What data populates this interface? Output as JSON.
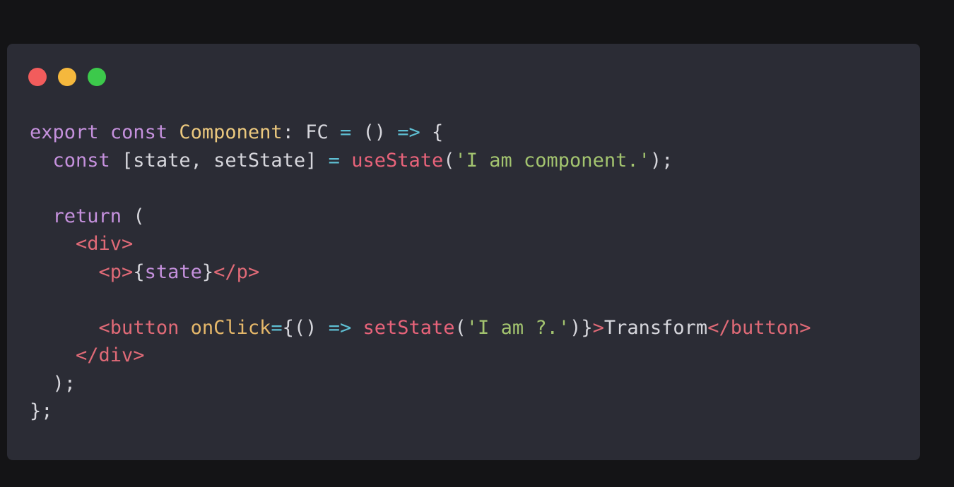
{
  "window": {
    "controls": [
      {
        "name": "close",
        "color": "#f25c5c"
      },
      {
        "name": "minimize",
        "color": "#f5b83d"
      },
      {
        "name": "maximize",
        "color": "#3cc94b"
      }
    ]
  },
  "code": {
    "language": "tsx",
    "lines": [
      [
        {
          "t": "export",
          "c": "kw"
        },
        {
          "t": " ",
          "c": "pl"
        },
        {
          "t": "const",
          "c": "kw"
        },
        {
          "t": " ",
          "c": "pl"
        },
        {
          "t": "Component",
          "c": "cls"
        },
        {
          "t": ": ",
          "c": "pl"
        },
        {
          "t": "FC",
          "c": "pl"
        },
        {
          "t": " ",
          "c": "pl"
        },
        {
          "t": "=",
          "c": "op"
        },
        {
          "t": " () ",
          "c": "pl"
        },
        {
          "t": "=>",
          "c": "op"
        },
        {
          "t": " {",
          "c": "pl"
        }
      ],
      [
        {
          "t": "  ",
          "c": "pl"
        },
        {
          "t": "const",
          "c": "kw"
        },
        {
          "t": " [state, setState] ",
          "c": "pl"
        },
        {
          "t": "=",
          "c": "op"
        },
        {
          "t": " ",
          "c": "pl"
        },
        {
          "t": "useState",
          "c": "fn"
        },
        {
          "t": "(",
          "c": "pl"
        },
        {
          "t": "'I am component.'",
          "c": "str"
        },
        {
          "t": ");",
          "c": "pl"
        }
      ],
      [],
      [
        {
          "t": "  ",
          "c": "pl"
        },
        {
          "t": "return",
          "c": "kw"
        },
        {
          "t": " (",
          "c": "pl"
        }
      ],
      [
        {
          "t": "    ",
          "c": "pl"
        },
        {
          "t": "<div>",
          "c": "tag"
        }
      ],
      [
        {
          "t": "      ",
          "c": "pl"
        },
        {
          "t": "<p>",
          "c": "tag"
        },
        {
          "t": "{",
          "c": "pl"
        },
        {
          "t": "state",
          "c": "kw"
        },
        {
          "t": "}",
          "c": "pl"
        },
        {
          "t": "</p>",
          "c": "tag"
        }
      ],
      [],
      [
        {
          "t": "      ",
          "c": "pl"
        },
        {
          "t": "<button",
          "c": "tag"
        },
        {
          "t": " ",
          "c": "pl"
        },
        {
          "t": "onClick",
          "c": "attr"
        },
        {
          "t": "=",
          "c": "op"
        },
        {
          "t": "{() ",
          "c": "pl"
        },
        {
          "t": "=>",
          "c": "op"
        },
        {
          "t": " ",
          "c": "pl"
        },
        {
          "t": "setState",
          "c": "fn"
        },
        {
          "t": "(",
          "c": "pl"
        },
        {
          "t": "'I am ?.'",
          "c": "str"
        },
        {
          "t": ")}",
          "c": "pl"
        },
        {
          "t": ">",
          "c": "tag"
        },
        {
          "t": "Transform",
          "c": "pl"
        },
        {
          "t": "</button>",
          "c": "tag"
        }
      ],
      [
        {
          "t": "    ",
          "c": "pl"
        },
        {
          "t": "</div>",
          "c": "tag"
        }
      ],
      [
        {
          "t": "  );",
          "c": "pl"
        }
      ],
      [
        {
          "t": "};",
          "c": "pl"
        }
      ]
    ]
  }
}
